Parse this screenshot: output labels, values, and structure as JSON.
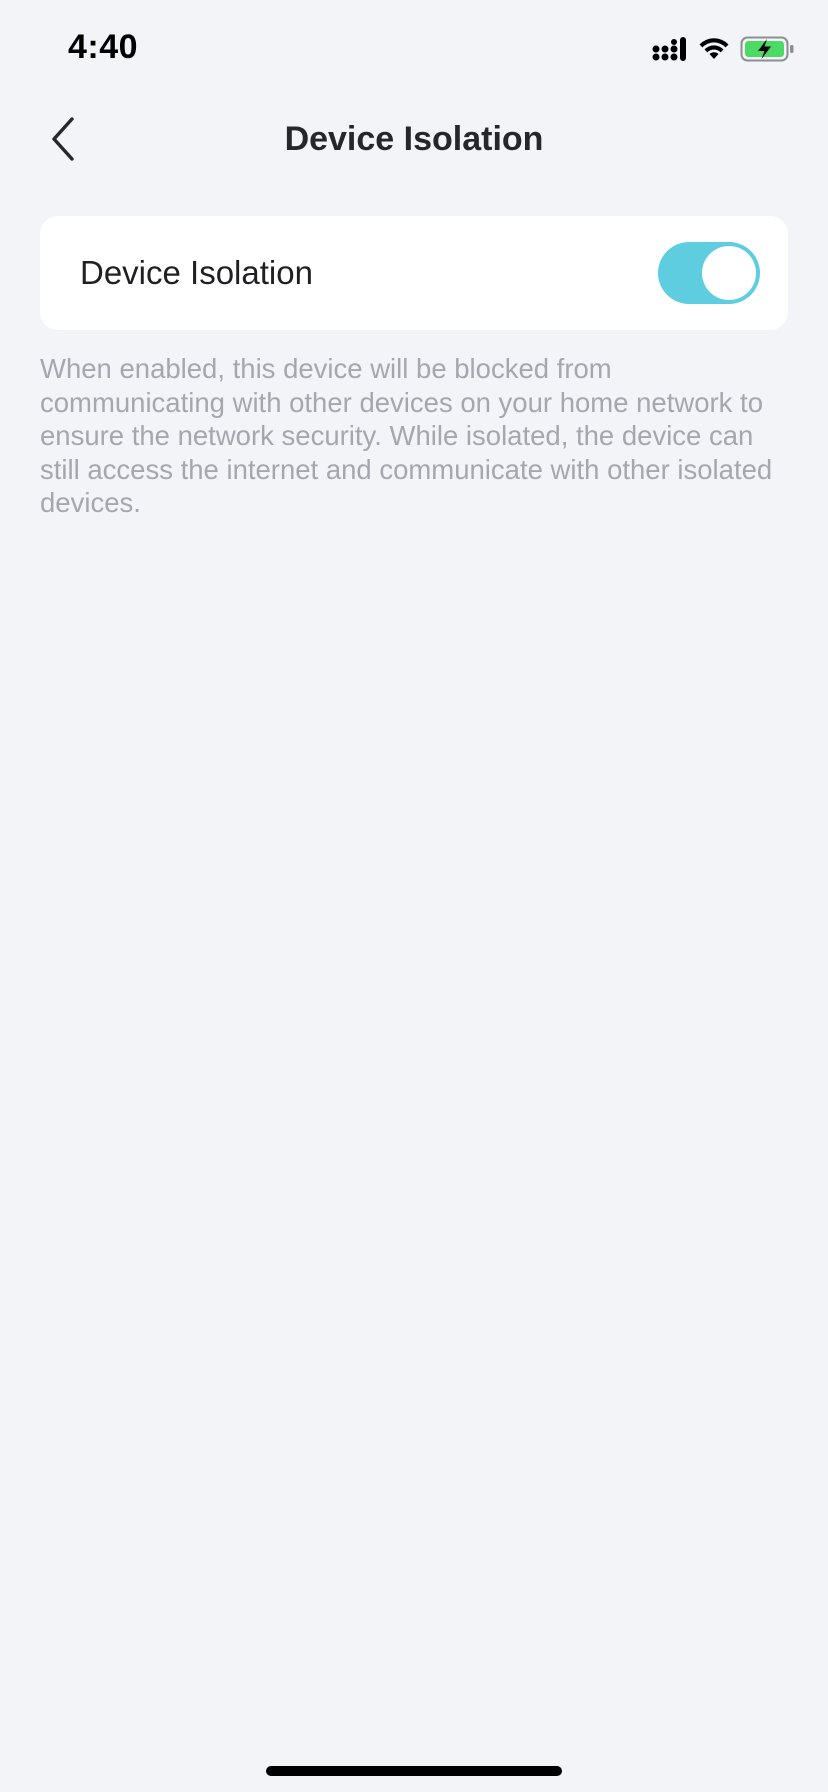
{
  "status_bar": {
    "time": "4:40",
    "icons": [
      "cellular-signal-icon",
      "wifi-icon",
      "battery-charging-icon"
    ]
  },
  "nav": {
    "title": "Device Isolation",
    "back_icon": "chevron-left-icon"
  },
  "setting": {
    "label": "Device Isolation",
    "enabled": true,
    "toggle_color": "#5ecde0"
  },
  "description": "When enabled, this device will be blocked from communicating with other devices on your home network to ensure the network security. While isolated, the device can still access the internet and communicate with other isolated devices.",
  "colors": {
    "background": "#f3f4f8",
    "card": "#ffffff",
    "accent": "#5ecde0",
    "battery_fill": "#4cd964"
  }
}
